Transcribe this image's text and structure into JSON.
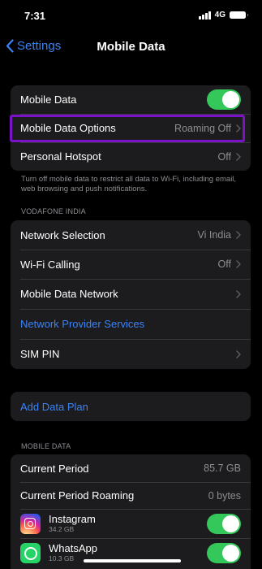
{
  "status": {
    "time": "7:31",
    "network": "4G"
  },
  "nav": {
    "back_label": "Settings",
    "title": "Mobile Data"
  },
  "group1": {
    "mobile_data": {
      "label": "Mobile Data",
      "toggle_on": true
    },
    "options": {
      "label": "Mobile Data Options",
      "value": "Roaming Off"
    },
    "hotspot": {
      "label": "Personal Hotspot",
      "value": "Off"
    }
  },
  "footnote": "Turn off mobile data to restrict all data to Wi-Fi, including email, web browsing and push notifications.",
  "carrier_header": "VODAFONE INDIA",
  "group2": {
    "network_selection": {
      "label": "Network Selection",
      "value": "Vi India"
    },
    "wifi_calling": {
      "label": "Wi-Fi Calling",
      "value": "Off"
    },
    "mobile_data_network": {
      "label": "Mobile Data Network"
    },
    "provider_services": {
      "label": "Network Provider Services"
    },
    "sim_pin": {
      "label": "SIM PIN"
    }
  },
  "add_data_plan": {
    "label": "Add Data Plan"
  },
  "usage_header": "MOBILE DATA",
  "usage": {
    "current_period": {
      "label": "Current Period",
      "value": "85.7 GB"
    },
    "current_period_roaming": {
      "label": "Current Period Roaming",
      "value": "0 bytes"
    }
  },
  "apps": [
    {
      "name": "Instagram",
      "size": "34.2 GB",
      "icon": "instagram-icon",
      "enabled": true
    },
    {
      "name": "WhatsApp",
      "size": "10.3 GB",
      "icon": "whatsapp-icon",
      "enabled": true
    }
  ],
  "colors": {
    "accent": "#3b82f6",
    "toggle_on": "#34c759",
    "highlight": "#7a12c8"
  }
}
